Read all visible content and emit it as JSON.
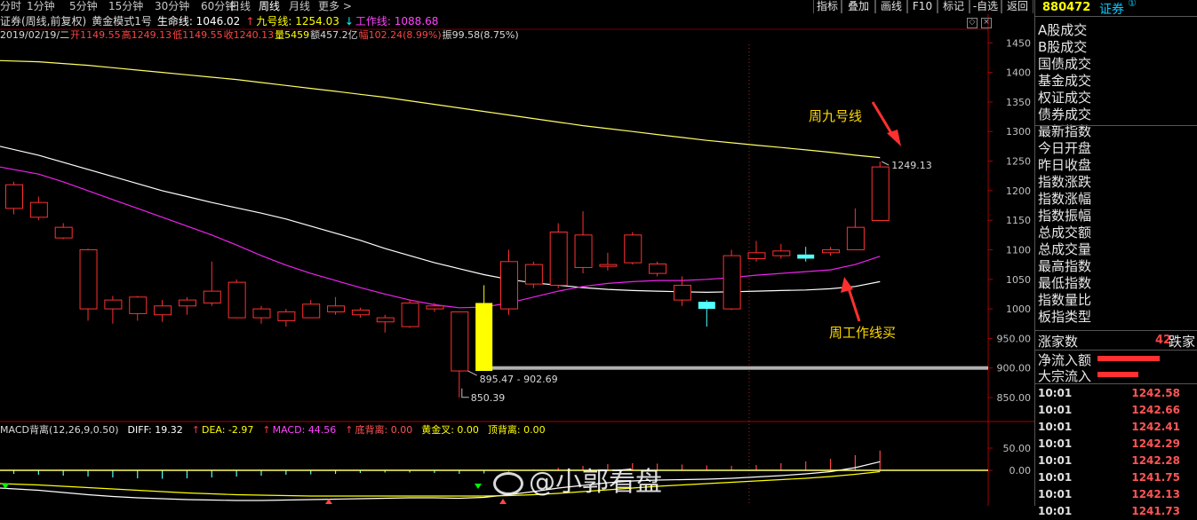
{
  "toolbar": {
    "periods": [
      {
        "label": "分时",
        "active": false
      },
      {
        "label": "1分钟",
        "active": false
      },
      {
        "label": "5分钟",
        "active": false
      },
      {
        "label": "15分钟",
        "active": false
      },
      {
        "label": "30分钟",
        "active": false
      },
      {
        "label": "60分钟",
        "active": false
      },
      {
        "label": "日线",
        "active": false
      },
      {
        "label": "周线",
        "active": true
      },
      {
        "label": "月线",
        "active": false
      },
      {
        "label": "更多 >",
        "active": false
      }
    ],
    "buttons": [
      "指标",
      "叠加",
      "画线",
      "F10",
      "标记",
      "-自选",
      "返回"
    ]
  },
  "header": {
    "code": "880472",
    "name": "证券",
    "badge": "①"
  },
  "info": {
    "line1": [
      {
        "text": "证券(周线,前复权)",
        "color": "#d8d8d8"
      },
      {
        "text": "黄金模式1号",
        "color": "#d8d8d8"
      },
      {
        "text": "生命线: 1046.02",
        "color": "#ffffff"
      },
      {
        "text": "↑",
        "color": "#ff3b3b"
      },
      {
        "text": "九号线: 1254.03",
        "color": "#ffff00"
      },
      {
        "text": "↓",
        "color": "#00ffff"
      },
      {
        "text": "工作线: 1088.68",
        "color": "#ff44ff"
      }
    ],
    "line2": [
      {
        "text": "2019/02/19/二",
        "color": "#d8d8d8"
      },
      {
        "text": "开1149.55",
        "color": "#ff4444"
      },
      {
        "text": "高1249.13",
        "color": "#ff4444"
      },
      {
        "text": "低1149.55",
        "color": "#ff4444"
      },
      {
        "text": "收1240.13",
        "color": "#ff4444"
      },
      {
        "text": "量5459",
        "color": "#ffff00"
      },
      {
        "text": "额457.2亿",
        "color": "#d8d8d8"
      },
      {
        "text": "幅102.24(8.99%)",
        "color": "#ff4444"
      },
      {
        "text": "振99.58(8.75%)",
        "color": "#d8d8d8"
      }
    ],
    "macd": [
      {
        "text": "MACD背离(12,26,9,0.50)",
        "color": "#d8d8d8"
      },
      {
        "text": "DIFF: 19.32",
        "color": "#ffffff"
      },
      {
        "text": "↑",
        "color": "#ff3b3b"
      },
      {
        "text": "DEA: -2.97",
        "color": "#ffff00"
      },
      {
        "text": "↑",
        "color": "#ff3b3b"
      },
      {
        "text": "MACD: 44.56",
        "color": "#ff44ff"
      },
      {
        "text": "↑",
        "color": "#ff3b3b"
      },
      {
        "text": "底背离: 0.00",
        "color": "#ff5555"
      },
      {
        "text": "黄金叉: 0.00",
        "color": "#ffff00"
      },
      {
        "text": "顶背离: 0.00",
        "color": "#ffff00"
      }
    ]
  },
  "sidebar_menu": [
    "A股成交",
    "B股成交",
    "国债成交",
    "基金成交",
    "权证成交",
    "债券成交",
    "最新指数",
    "今日开盘",
    "昨日收盘",
    "指数涨跌",
    "指数涨幅",
    "指数振幅",
    "总成交额",
    "总成交量",
    "最高指数",
    "最低指数",
    "指数量比",
    "板指类型"
  ],
  "stats": {
    "rise_label": "涨家数",
    "rise_value": "42",
    "fall_label": "跌家",
    "net_inflow_label": "净流入额",
    "big_inflow_label": "大宗流入"
  },
  "ticks": [
    {
      "time": "10:01",
      "value": "1242.58"
    },
    {
      "time": "10:01",
      "value": "1242.66"
    },
    {
      "time": "10:01",
      "value": "1242.41"
    },
    {
      "time": "10:01",
      "value": "1242.29"
    },
    {
      "time": "10:01",
      "value": "1242.28"
    },
    {
      "time": "10:01",
      "value": "1241.75"
    },
    {
      "time": "10:01",
      "value": "1242.13"
    },
    {
      "time": "10:01",
      "value": "1241.73"
    }
  ],
  "annotations": {
    "nine_line": "周九号线",
    "work_line_buy": "周工作线买"
  },
  "watermark": "@小郭看盘",
  "chart_data": {
    "type": "candlestick",
    "ylim": [
      820,
      1470
    ],
    "y_ticks": [
      "1450",
      "1400",
      "1350",
      "1300",
      "1250",
      "1200",
      "1150",
      "1100",
      "1050",
      "1000",
      "950.00",
      "900.00",
      "850.00"
    ],
    "y_tick_values": [
      1450,
      1400,
      1350,
      1300,
      1250,
      1200,
      1150,
      1100,
      1050,
      1000,
      950,
      900,
      850
    ],
    "labels": {
      "high": "1249.13",
      "range": "895.47 - 902.69",
      "low": "850.39"
    },
    "support_level": 900,
    "candles": [
      {
        "o": 1170,
        "c": 1210,
        "h": 1215,
        "l": 1160
      },
      {
        "o": 1155,
        "c": 1180,
        "h": 1190,
        "l": 1150
      },
      {
        "o": 1120,
        "c": 1138,
        "h": 1145,
        "l": 1118
      },
      {
        "o": 1000,
        "c": 1100,
        "h": 1102,
        "l": 980
      },
      {
        "o": 1000,
        "c": 1015,
        "h": 1022,
        "l": 975
      },
      {
        "o": 992,
        "c": 1020,
        "h": 1022,
        "l": 980
      },
      {
        "o": 990,
        "c": 1005,
        "h": 1015,
        "l": 978
      },
      {
        "o": 1005,
        "c": 1015,
        "h": 1020,
        "l": 990
      },
      {
        "o": 1010,
        "c": 1030,
        "h": 1080,
        "l": 1005
      },
      {
        "o": 985,
        "c": 1045,
        "h": 1050,
        "l": 984
      },
      {
        "o": 985,
        "c": 1000,
        "h": 1005,
        "l": 975
      },
      {
        "o": 980,
        "c": 995,
        "h": 1000,
        "l": 970
      },
      {
        "o": 985,
        "c": 1008,
        "h": 1015,
        "l": 985
      },
      {
        "o": 995,
        "c": 1005,
        "h": 1020,
        "l": 990
      },
      {
        "o": 990,
        "c": 998,
        "h": 1002,
        "l": 985
      },
      {
        "o": 978,
        "c": 985,
        "h": 990,
        "l": 960
      },
      {
        "o": 970,
        "c": 1010,
        "h": 1015,
        "l": 968
      },
      {
        "o": 1000,
        "c": 1005,
        "h": 1010,
        "l": 995
      },
      {
        "o": 895,
        "c": 995,
        "h": 995,
        "l": 850
      },
      {
        "o": 895,
        "c": 1010,
        "h": 1040,
        "l": 895
      },
      {
        "o": 1000,
        "c": 1080,
        "h": 1100,
        "l": 990
      },
      {
        "o": 1042,
        "c": 1075,
        "h": 1080,
        "l": 1035
      },
      {
        "o": 1040,
        "c": 1130,
        "h": 1145,
        "l": 1035
      },
      {
        "o": 1070,
        "c": 1125,
        "h": 1165,
        "l": 1060
      },
      {
        "o": 1072,
        "c": 1075,
        "h": 1095,
        "l": 1065
      },
      {
        "o": 1078,
        "c": 1125,
        "h": 1130,
        "l": 1075
      },
      {
        "o": 1060,
        "c": 1076,
        "h": 1080,
        "l": 1055
      },
      {
        "o": 1015,
        "c": 1040,
        "h": 1055,
        "l": 1005
      },
      {
        "o": 1012,
        "c": 1000,
        "h": 1015,
        "l": 970
      },
      {
        "o": 1000,
        "c": 1090,
        "h": 1100,
        "l": 998
      },
      {
        "o": 1085,
        "c": 1095,
        "h": 1115,
        "l": 1080
      },
      {
        "o": 1090,
        "c": 1098,
        "h": 1110,
        "l": 1085
      },
      {
        "o": 1092,
        "c": 1085,
        "h": 1105,
        "l": 1080
      },
      {
        "o": 1095,
        "c": 1100,
        "h": 1105,
        "l": 1090
      },
      {
        "o": 1100,
        "c": 1138,
        "h": 1170,
        "l": 1100
      },
      {
        "o": 1149.55,
        "c": 1240.13,
        "h": 1249.13,
        "l": 1149.55
      }
    ],
    "series": [
      {
        "name": "九号线",
        "color": "#ffff66",
        "values": [
          1420,
          1418,
          1415,
          1412,
          1408,
          1404,
          1400,
          1396,
          1392,
          1388,
          1383,
          1378,
          1373,
          1368,
          1363,
          1358,
          1352,
          1346,
          1340,
          1334,
          1328,
          1322,
          1316,
          1310,
          1305,
          1300,
          1295,
          1290,
          1285,
          1281,
          1277,
          1273,
          1269,
          1265,
          1260,
          1256
        ]
      },
      {
        "name": "生命线",
        "color": "#ffffff",
        "values": [
          1275,
          1260,
          1248,
          1236,
          1224,
          1212,
          1200,
          1190,
          1180,
          1171,
          1162,
          1152,
          1140,
          1128,
          1116,
          1102,
          1090,
          1078,
          1068,
          1058,
          1050,
          1044,
          1040,
          1036,
          1033,
          1031,
          1030,
          1029,
          1028,
          1029,
          1030,
          1031,
          1032,
          1034,
          1038,
          1046
        ]
      },
      {
        "name": "工作线",
        "color": "#ee22ee",
        "values": [
          1240,
          1228,
          1215,
          1200,
          1185,
          1170,
          1155,
          1140,
          1125,
          1108,
          1090,
          1074,
          1060,
          1048,
          1036,
          1025,
          1015,
          1007,
          1002,
          1003,
          1010,
          1020,
          1030,
          1038,
          1043,
          1046,
          1048,
          1048,
          1050,
          1053,
          1057,
          1060,
          1063,
          1066,
          1075,
          1089
        ]
      }
    ],
    "macd": {
      "ylim": [
        -80,
        80
      ],
      "y_ticks": [
        "50.00",
        "0.00"
      ],
      "y_tick_values": [
        50,
        0
      ],
      "hist": [
        -8,
        -10,
        -12,
        -14,
        -16,
        -18,
        -19,
        -18,
        -16,
        -14,
        -12,
        -10,
        -9,
        -8,
        -6,
        -5,
        -5,
        -6,
        -8,
        -7,
        -3,
        2,
        6,
        10,
        14,
        16,
        15,
        13,
        11,
        10,
        12,
        16,
        20,
        26,
        34,
        44.56
      ],
      "dif": [
        -40,
        -45,
        -50,
        -55,
        -59,
        -62,
        -64,
        -66,
        -67,
        -68,
        -68,
        -67,
        -66,
        -65,
        -64,
        -63,
        -62,
        -62,
        -63,
        -61,
        -55,
        -48,
        -40,
        -34,
        -28,
        -24,
        -22,
        -21,
        -20,
        -18,
        -15,
        -12,
        -8,
        -3,
        6,
        19.32
      ],
      "dea": [
        -30,
        -33,
        -36,
        -39,
        -42,
        -45,
        -48,
        -51,
        -53,
        -55,
        -56,
        -57,
        -58,
        -58,
        -58,
        -58,
        -58,
        -58,
        -58,
        -58,
        -57,
        -55,
        -52,
        -48,
        -44,
        -40,
        -36,
        -33,
        -30,
        -27,
        -24,
        -21,
        -18,
        -14,
        -9,
        -2.97
      ]
    }
  }
}
